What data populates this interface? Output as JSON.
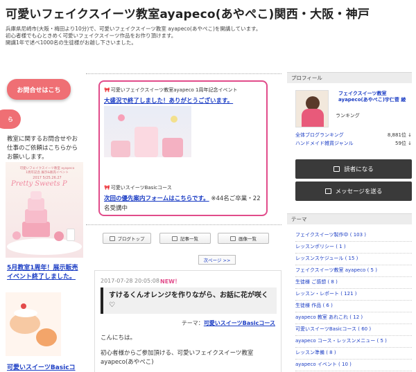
{
  "header": {
    "title": "可愛いフェイクスイーツ教室ayapeco(あやぺこ)関西・大阪・神戸",
    "desc_lines": [
      "兵庫県尼崎市(大阪・梅田より10分)で、可愛いフェイクスイーツ教室 ayapeco(あやぺこ)を開講しています。",
      "初心者様でも心ときめく可愛いフェイクスイーツ作品をお作り頂けます。",
      "開講1年で述べ1000名の生徒様がお越し下さいました。"
    ]
  },
  "left": {
    "contact_label": "お問合せはこち",
    "pill_label": "ら",
    "contact_text": "教室に関するお問合せやお仕事のご依頼はこちらからお願いします。",
    "banner_small1": "可愛いフェイクスイーツ教室 ayapeco",
    "banner_small2": "1周年記念 展示&販売イベント",
    "banner_date": "2017 5/25.26.27",
    "banner_title": "Pretty Sweets P",
    "link1": "5月教室1周年！展示販売イベント終了しました。",
    "link2": "可愛いスイーツBasicコ"
  },
  "event": {
    "label1": "可愛いフェイクスイーツ教室ayapeco 1周年記念イベント",
    "link1": "大盛況で終了しました！ありがとうございます。",
    "label2": "可愛いスイーツBasicコース",
    "link2": "次回の優先案内フォームはこちらです。",
    "note": "※44名ご卒業・22名受講中"
  },
  "nav": {
    "blog_top": "ブログトップ",
    "articles": "記事一覧",
    "images": "画像一覧",
    "next_page": "次ページ >>"
  },
  "article": {
    "date": "2017-07-28 20:05:08",
    "new_badge": "NEW！",
    "title": "すけるくんオレンジを作りながら、お話に花が咲く♡",
    "theme_label": "テーマ：",
    "theme_link": "可愛いスイーツBasicコース",
    "body1": "こんにちは。",
    "body2": "初心者様からご参加頂ける、可愛いフェイクスイーツ教室ayapeco(あやぺこ)"
  },
  "profile": {
    "heading": "プロフィール",
    "name": "フェイクスイーツ教室ayapeco(あやぺこ)宇仁菅 綾",
    "ranking_label": "ランキング",
    "rankings": [
      {
        "name": "全体ブログランキング",
        "value": "8,881位 ↓"
      },
      {
        "name": "ハンドメイド雑貨ジャンル",
        "value": "59位 ↓"
      }
    ],
    "reader_button": "読者になる",
    "message_button": "メッセージを送る"
  },
  "themes": {
    "heading": "テーマ",
    "items": [
      "フェイクスイーツ製作中 ( 103 )",
      "レッスンポリシー ( 1 )",
      "レッスンスケジュール ( 15 )",
      "フェイクスイーツ教室 ayapeco ( 5 )",
      "生徒様 ご感想 ( 8 )",
      "レッスン・レポート ( 121 )",
      "生徒様 作品 ( 6 )",
      "ayapeco 教室 あれこれ ( 12 )",
      "可愛いスイーツBasicコース ( 60 )",
      "ayapeco コース・レッスンメニュー ( 5 )",
      "レッスン準備 ( 8 )",
      "ayapeco イベント ( 10 )"
    ]
  },
  "colors": {
    "accent_pink": "#e14b8a",
    "contact_coral": "#ef6f74",
    "link_blue": "#1a3cc4",
    "button_dark": "#3a3a3a"
  }
}
